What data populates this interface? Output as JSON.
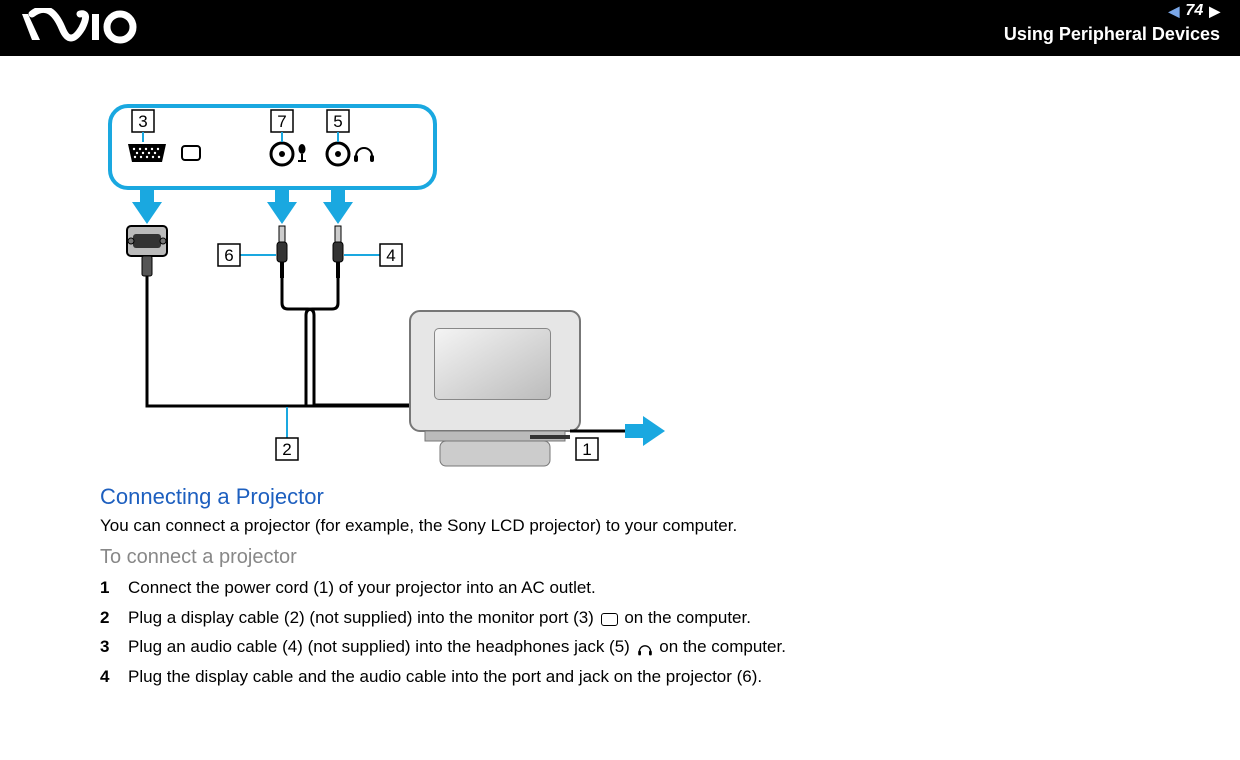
{
  "header": {
    "page_number": "74",
    "section": "Using Peripheral Devices"
  },
  "diagram": {
    "callouts": {
      "c1": "1",
      "c2": "2",
      "c3": "3",
      "c4": "4",
      "c5": "5",
      "c6": "6",
      "c7": "7"
    }
  },
  "section_heading": "Connecting a Projector",
  "intro_text": "You can connect a projector (for example, the Sony LCD projector) to your computer.",
  "subheading": "To connect a projector",
  "steps": [
    {
      "num": "1",
      "text": "Connect the power cord (1) of your projector into an AC outlet."
    },
    {
      "num": "2",
      "pre": "Plug a display cable (2) (not supplied) into the monitor port (3) ",
      "icon": "monitor",
      "post": " on the computer."
    },
    {
      "num": "3",
      "pre": "Plug an audio cable (4) (not supplied) into the headphones jack (5) ",
      "icon": "headphones",
      "post": " on the computer."
    },
    {
      "num": "4",
      "text": "Plug the display cable and the audio cable into the port and jack on the projector (6)."
    }
  ]
}
